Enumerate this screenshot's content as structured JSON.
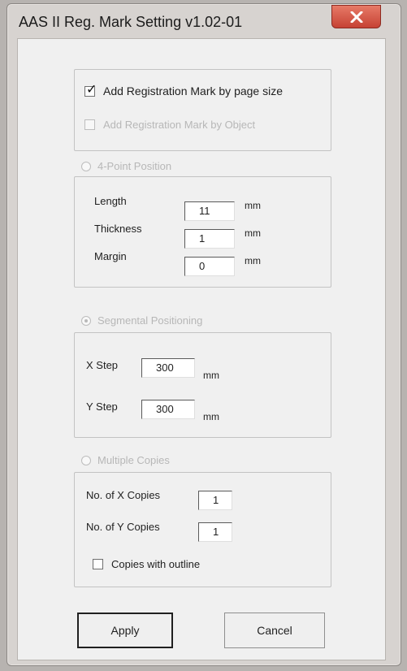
{
  "window": {
    "title": "AAS II Reg. Mark Setting v1.02-01"
  },
  "registration": {
    "page_size_checkbox": {
      "label": "Add Registration Mark by page size",
      "checked": true,
      "enabled": true
    },
    "object_checkbox": {
      "label": "Add Registration Mark by Object",
      "checked": false,
      "enabled": false
    }
  },
  "four_point": {
    "radio_label": "4-Point Position",
    "selected": false,
    "enabled": false,
    "fields": [
      {
        "label": "Length",
        "value": "11",
        "unit": "mm"
      },
      {
        "label": "Thickness",
        "value": "1",
        "unit": "mm"
      },
      {
        "label": "Margin",
        "value": "0",
        "unit": "mm"
      }
    ]
  },
  "segmental": {
    "radio_label": "Segmental Positioning",
    "selected": true,
    "enabled": false,
    "fields": [
      {
        "label": "X Step",
        "value": "300",
        "unit": "mm"
      },
      {
        "label": "Y Step",
        "value": "300",
        "unit": "mm"
      }
    ]
  },
  "multiple": {
    "radio_label": "Multiple Copies",
    "selected": false,
    "enabled": false,
    "fields": [
      {
        "label": "No. of X Copies",
        "value": "1"
      },
      {
        "label": "No. of Y Copies",
        "value": "1"
      }
    ],
    "outline_checkbox": {
      "label": "Copies with outline",
      "checked": false,
      "enabled": true
    }
  },
  "buttons": {
    "apply": "Apply",
    "cancel": "Cancel"
  },
  "icons": {
    "close": "close-icon",
    "checkmark": "checkmark-icon",
    "radio_dot": "radio-dot-icon"
  },
  "colors": {
    "close_button": "#d45848",
    "dialog_background": "#f0f0f0",
    "disabled_text": "#b7b7b7"
  }
}
